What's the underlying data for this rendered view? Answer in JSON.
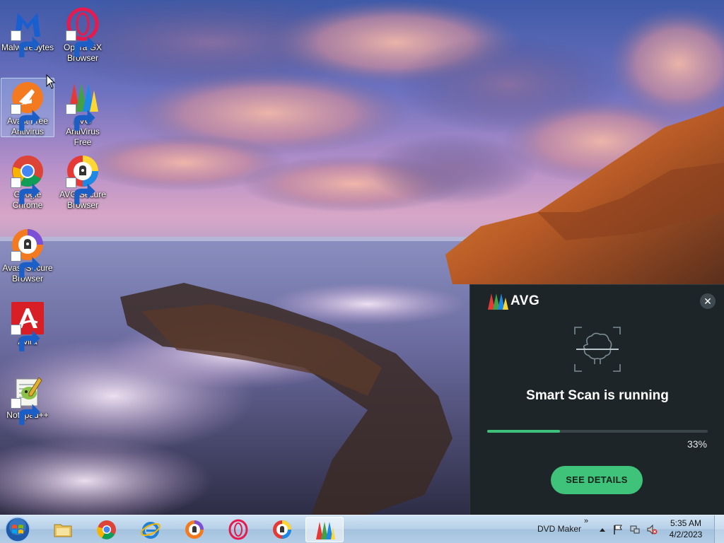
{
  "desktop": {
    "icons": [
      {
        "label": "Malwarebytes"
      },
      {
        "label": "Opera GX Browser"
      },
      {
        "label": "Avast Free Antivirus"
      },
      {
        "label": "AVG AntiVirus Free"
      },
      {
        "label": "Google Chrome"
      },
      {
        "label": "AVG Secure Browser"
      },
      {
        "label": "Avast Secure Browser"
      },
      {
        "label": "Avira"
      },
      {
        "label": "Notepad++"
      }
    ]
  },
  "avg_popup": {
    "brand": "AVG",
    "close_icon": "close-icon",
    "status": "Smart Scan is running",
    "progress": 0.33,
    "progress_label": "33%",
    "button_label": "SEE DETAILS",
    "colors": {
      "background": "#1d2529",
      "accent": "#3fc37b"
    }
  },
  "taskbar": {
    "apps": [
      {
        "name": "File Explorer",
        "icon": "folder-icon"
      },
      {
        "name": "Google Chrome",
        "icon": "chrome-icon"
      },
      {
        "name": "Internet Explorer",
        "icon": "ie-icon"
      },
      {
        "name": "Avast Secure Browser",
        "icon": "avast-browser-icon"
      },
      {
        "name": "Opera GX",
        "icon": "opera-icon"
      },
      {
        "name": "AVG Secure Browser",
        "icon": "avg-browser-icon"
      },
      {
        "name": "AVG AntiVirus",
        "icon": "avg-icon"
      }
    ],
    "toolbar_label": "DVD Maker",
    "toolbar_chevron": "»",
    "clock": {
      "time": "5:35 AM",
      "date": "4/2/2023"
    }
  }
}
